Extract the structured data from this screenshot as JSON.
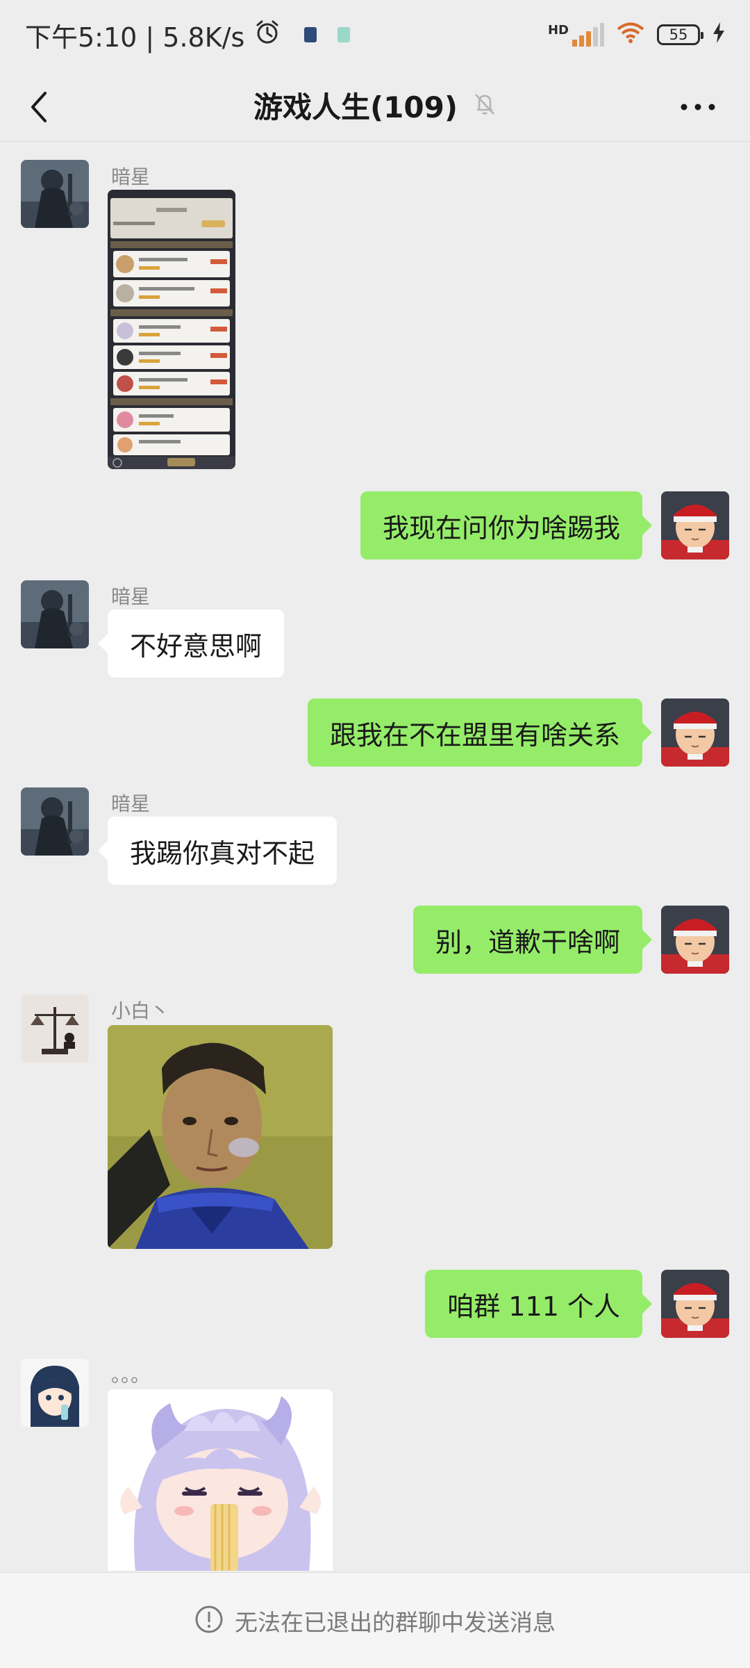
{
  "status_bar": {
    "time_speed": "下午5:10 | 5.8K/s",
    "network": "HD",
    "battery": "55"
  },
  "header": {
    "title": "游戏人生(109)"
  },
  "messages": [
    {
      "side": "left",
      "sender": "暗星",
      "type": "image"
    },
    {
      "side": "right",
      "text": "我现在问你为啥踢我"
    },
    {
      "side": "left",
      "sender": "暗星",
      "text": "不好意思啊"
    },
    {
      "side": "right",
      "text": "跟我在不在盟里有啥关系"
    },
    {
      "side": "left",
      "sender": "暗星",
      "text": "我踢你真对不起"
    },
    {
      "side": "right",
      "text": "别，道歉干啥啊"
    },
    {
      "side": "left",
      "sender": "小白丶",
      "type": "image"
    },
    {
      "side": "right",
      "text": "咱群 111 个人"
    },
    {
      "side": "left",
      "sender": "。。。",
      "type": "image"
    }
  ],
  "footer": {
    "notice": "无法在已退出的群聊中发送消息"
  },
  "colors": {
    "background": "#ededed",
    "outgoing_bubble": "#95ec69",
    "incoming_bubble": "#ffffff"
  },
  "icons": [
    "alarm-icon",
    "signal-icon",
    "wifi-icon",
    "battery-icon",
    "charging-icon",
    "back-arrow-icon",
    "mute-bell-icon",
    "more-icon",
    "info-icon"
  ]
}
